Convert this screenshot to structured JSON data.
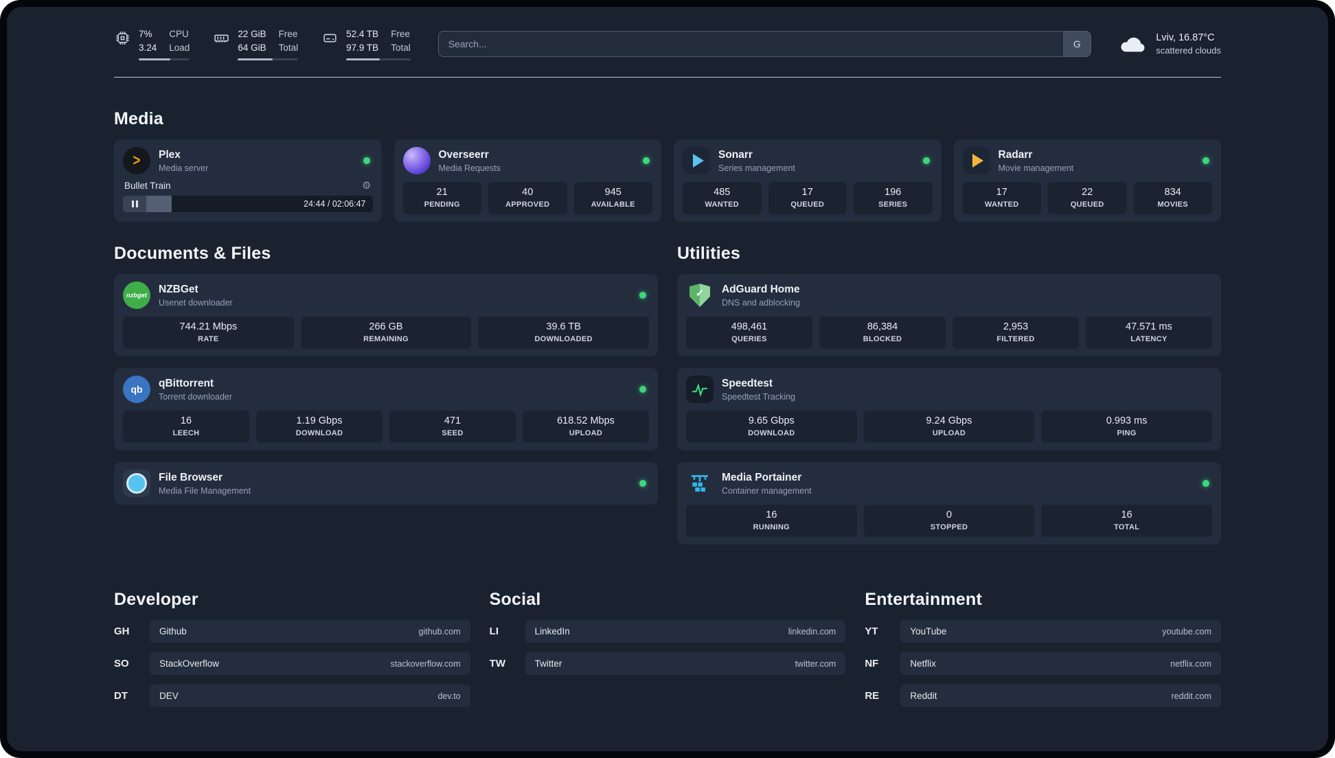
{
  "topbar": {
    "cpu": {
      "value1": "7%",
      "value2": "3.24",
      "label1": "CPU",
      "label2": "Load",
      "fill": 62
    },
    "ram": {
      "value1": "22 GiB",
      "value2": "64 GiB",
      "label1": "Free",
      "label2": "Total",
      "fill": 58
    },
    "disk": {
      "value1": "52.4 TB",
      "value2": "97.9 TB",
      "label1": "Free",
      "label2": "Total",
      "fill": 52
    },
    "search": {
      "placeholder": "Search...",
      "provider_label": "G"
    },
    "weather": {
      "location": "Lviv, 16.87°C",
      "condition": "scattered clouds"
    }
  },
  "icons": {
    "nzbget_text": "nzbget",
    "qbittorrent_text": "qb"
  },
  "media": {
    "title": "Media",
    "cards": [
      {
        "name": "Plex",
        "desc": "Media server",
        "player": {
          "track": "Bullet Train",
          "time": "24:44 / 02:06:47",
          "progress": 19.5
        }
      },
      {
        "name": "Overseerr",
        "desc": "Media Requests",
        "stats": [
          {
            "value": "21",
            "label": "PENDING"
          },
          {
            "value": "40",
            "label": "APPROVED"
          },
          {
            "value": "945",
            "label": "AVAILABLE"
          }
        ]
      },
      {
        "name": "Sonarr",
        "desc": "Series management",
        "stats": [
          {
            "value": "485",
            "label": "WANTED"
          },
          {
            "value": "17",
            "label": "QUEUED"
          },
          {
            "value": "196",
            "label": "SERIES"
          }
        ]
      },
      {
        "name": "Radarr",
        "desc": "Movie management",
        "stats": [
          {
            "value": "17",
            "label": "WANTED"
          },
          {
            "value": "22",
            "label": "QUEUED"
          },
          {
            "value": "834",
            "label": "MOVIES"
          }
        ]
      }
    ]
  },
  "documents": {
    "title": "Documents & Files",
    "cards": [
      {
        "name": "NZBGet",
        "desc": "Usenet downloader",
        "stats": [
          {
            "value": "744.21 Mbps",
            "label": "RATE"
          },
          {
            "value": "266 GB",
            "label": "REMAINING"
          },
          {
            "value": "39.6 TB",
            "label": "DOWNLOADED"
          }
        ]
      },
      {
        "name": "qBittorrent",
        "desc": "Torrent downloader",
        "stats": [
          {
            "value": "16",
            "label": "LEECH"
          },
          {
            "value": "1.19 Gbps",
            "label": "DOWNLOAD"
          },
          {
            "value": "471",
            "label": "SEED"
          },
          {
            "value": "618.52 Mbps",
            "label": "UPLOAD"
          }
        ]
      },
      {
        "name": "File Browser",
        "desc": "Media File Management"
      }
    ]
  },
  "utilities": {
    "title": "Utilities",
    "cards": [
      {
        "name": "AdGuard Home",
        "desc": "DNS and adblocking",
        "stats": [
          {
            "value": "498,461",
            "label": "QUERIES"
          },
          {
            "value": "86,384",
            "label": "BLOCKED"
          },
          {
            "value": "2,953",
            "label": "FILTERED"
          },
          {
            "value": "47.571 ms",
            "label": "LATENCY"
          }
        ]
      },
      {
        "name": "Speedtest",
        "desc": "Speedtest Tracking",
        "stats": [
          {
            "value": "9.65 Gbps",
            "label": "DOWNLOAD"
          },
          {
            "value": "9.24 Gbps",
            "label": "UPLOAD"
          },
          {
            "value": "0.993 ms",
            "label": "PING"
          }
        ]
      },
      {
        "name": "Media Portainer",
        "desc": "Container management",
        "stats": [
          {
            "value": "16",
            "label": "RUNNING"
          },
          {
            "value": "0",
            "label": "STOPPED"
          },
          {
            "value": "16",
            "label": "TOTAL"
          }
        ]
      }
    ]
  },
  "bookmarks": {
    "groups": [
      {
        "title": "Developer",
        "items": [
          {
            "abbr": "GH",
            "name": "Github",
            "url": "github.com"
          },
          {
            "abbr": "SO",
            "name": "StackOverflow",
            "url": "stackoverflow.com"
          },
          {
            "abbr": "DT",
            "name": "DEV",
            "url": "dev.to"
          }
        ]
      },
      {
        "title": "Social",
        "items": [
          {
            "abbr": "LI",
            "name": "LinkedIn",
            "url": "linkedin.com"
          },
          {
            "abbr": "TW",
            "name": "Twitter",
            "url": "twitter.com"
          }
        ]
      },
      {
        "title": "Entertainment",
        "items": [
          {
            "abbr": "YT",
            "name": "YouTube",
            "url": "youtube.com"
          },
          {
            "abbr": "NF",
            "name": "Netflix",
            "url": "netflix.com"
          },
          {
            "abbr": "RE",
            "name": "Reddit",
            "url": "reddit.com"
          }
        ]
      }
    ]
  }
}
